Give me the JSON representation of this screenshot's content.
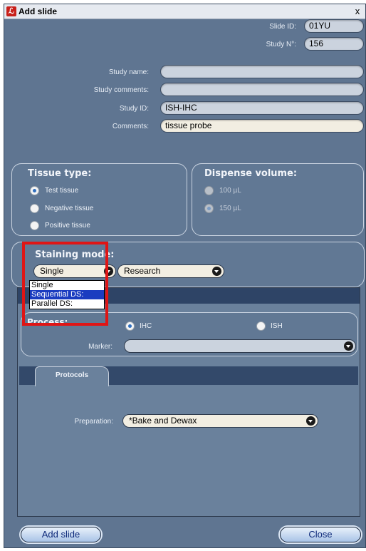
{
  "window": {
    "title": "Add slide",
    "close": "x"
  },
  "slide": {
    "slide_id_label": "Slide ID:",
    "slide_id_value": "01YU",
    "study_n_label": "Study N°:",
    "study_n_value": "156",
    "study_name_label": "Study name:",
    "study_name_value": "",
    "study_comments_label": "Study comments:",
    "study_comments_value": "",
    "study_id_label": "Study ID:",
    "study_id_value": "ISH-IHC",
    "comments_label": "Comments:",
    "comments_value": "tissue probe"
  },
  "tissue": {
    "title": "Tissue type:",
    "options": [
      "Test tissue",
      "Negative tissue",
      "Positive tissue"
    ],
    "selected": "Test tissue"
  },
  "dispense": {
    "title": "Dispense volume:",
    "options": [
      "100 µL",
      "150 µL"
    ],
    "selected": "150 µL"
  },
  "staining": {
    "title": "Staining mode:",
    "mode_value": "Single",
    "research_value": "Research",
    "dropdown_options": [
      "Single",
      "Sequential DS:",
      "Parallel DS:"
    ],
    "dropdown_selected": "Sequential DS:"
  },
  "process": {
    "label": "Process:",
    "options": [
      "IHC",
      "ISH"
    ],
    "selected": "IHC",
    "marker_label": "Marker:",
    "marker_value": ""
  },
  "protocols": {
    "tab_label": "Protocols",
    "preparation_label": "Preparation:",
    "preparation_value": "*Bake and Dewax"
  },
  "buttons": {
    "add_slide": "Add slide",
    "close": "Close"
  },
  "colors": {
    "window_bg": "#5f7591",
    "highlight": "#e01515",
    "dropdown_selected": "#1a3cc0"
  }
}
